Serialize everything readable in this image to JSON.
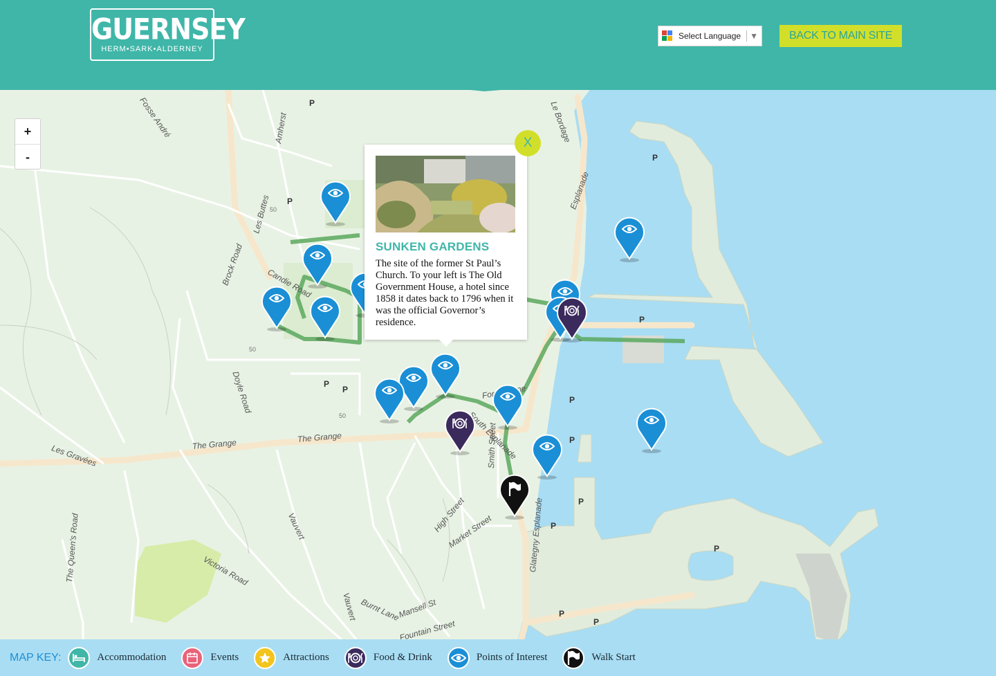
{
  "header": {
    "logo_title": "GUERNSEY",
    "logo_subtitle": "HERM•SARK•ALDERNEY",
    "language_label": "Select Language",
    "back_button": "BACK TO MAIN SITE",
    "colors": {
      "header_bg": "#3fb6a8",
      "button_bg": "#d2df2a",
      "sea": "#a9ddf3",
      "land": "#e8f2e4"
    }
  },
  "map": {
    "zoom_in": "+",
    "zoom_out": "-",
    "street_labels": [
      "Fosse André",
      "Amherst",
      "Les Buttes",
      "Candie Road",
      "Brock Road",
      "Doyle Road",
      "Les Gravées",
      "The Grange",
      "The Grange",
      "Vauvert",
      "Victoria Road",
      "The Queen's Road",
      "Vauvert",
      "Burnt Lane",
      "Mansell St",
      "Fountain Street",
      "Market Street",
      "High Street",
      "Smith Street",
      "South Esplanade",
      "Glategny Esplanade",
      "Esplanade",
      "Le Bordage",
      "Forest Lane"
    ],
    "parking_label": "P",
    "contour_labels": [
      "50",
      "50",
      "50"
    ],
    "markers": [
      {
        "type": "poi",
        "icon": "eye-icon"
      },
      {
        "type": "poi",
        "icon": "eye-icon"
      },
      {
        "type": "poi",
        "icon": "eye-icon"
      },
      {
        "type": "poi",
        "icon": "eye-icon"
      },
      {
        "type": "poi",
        "icon": "eye-icon"
      },
      {
        "type": "poi",
        "icon": "eye-icon"
      },
      {
        "type": "poi",
        "icon": "eye-icon"
      },
      {
        "type": "poi",
        "icon": "eye-icon"
      },
      {
        "type": "poi",
        "icon": "eye-icon"
      },
      {
        "type": "poi",
        "icon": "eye-icon"
      },
      {
        "type": "poi",
        "icon": "eye-icon"
      },
      {
        "type": "poi",
        "icon": "eye-icon"
      },
      {
        "type": "poi",
        "icon": "eye-icon"
      },
      {
        "type": "poi",
        "icon": "eye-icon"
      },
      {
        "type": "food",
        "icon": "plate-icon"
      },
      {
        "type": "food",
        "icon": "plate-icon"
      },
      {
        "type": "start",
        "icon": "flag-icon"
      }
    ]
  },
  "popup": {
    "close_label": "X",
    "title": "SUNKEN GARDENS",
    "description": "The site of the former St Paul’s Church. To your left is The Old Government House, a hotel since 1858 it dates back to 1796 when it was the official Governor’s residence."
  },
  "map_key": {
    "title": "MAP KEY:",
    "items": [
      {
        "label": "Accommodation",
        "icon": "bed-icon",
        "color": "#3fb6a8"
      },
      {
        "label": "Events",
        "icon": "calendar-icon",
        "color": "#e8637a"
      },
      {
        "label": "Attractions",
        "icon": "star-icon",
        "color": "#f3c41d"
      },
      {
        "label": "Food & Drink",
        "icon": "plate-icon",
        "color": "#3b2a5c"
      },
      {
        "label": "Points of Interest",
        "icon": "eye-icon",
        "color": "#1a8fd6"
      },
      {
        "label": "Walk Start",
        "icon": "flag-icon",
        "color": "#111111"
      }
    ]
  }
}
